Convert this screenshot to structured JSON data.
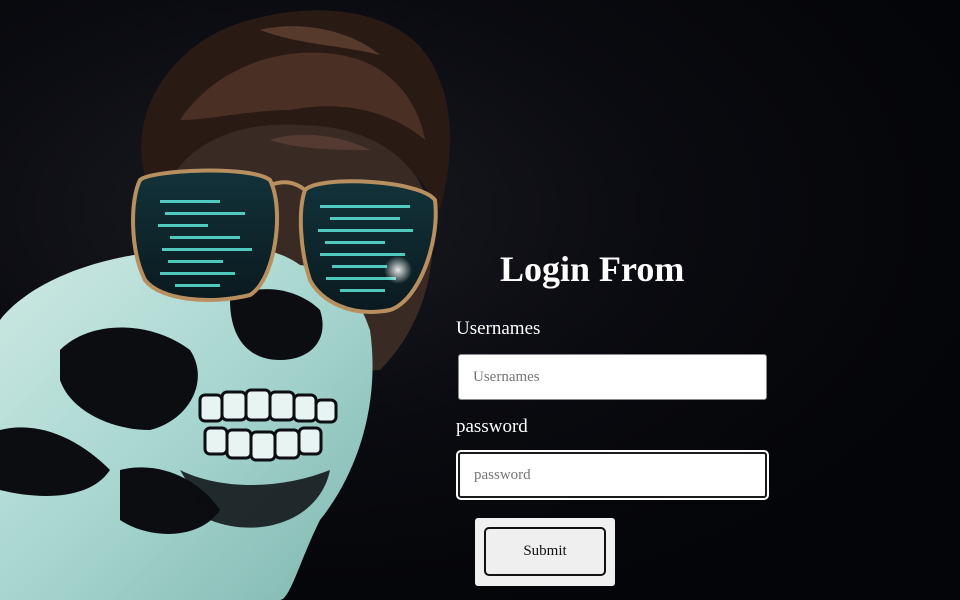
{
  "form": {
    "title": "Login From",
    "username_label": "Usernames",
    "username_placeholder": "Usernames",
    "username_value": "",
    "password_label": "password",
    "password_placeholder": "password",
    "password_value": "",
    "submit_label": "Submit"
  },
  "background": {
    "subject": "masked-person-with-glasses-photo",
    "accent_color": "#3fd6c8"
  }
}
